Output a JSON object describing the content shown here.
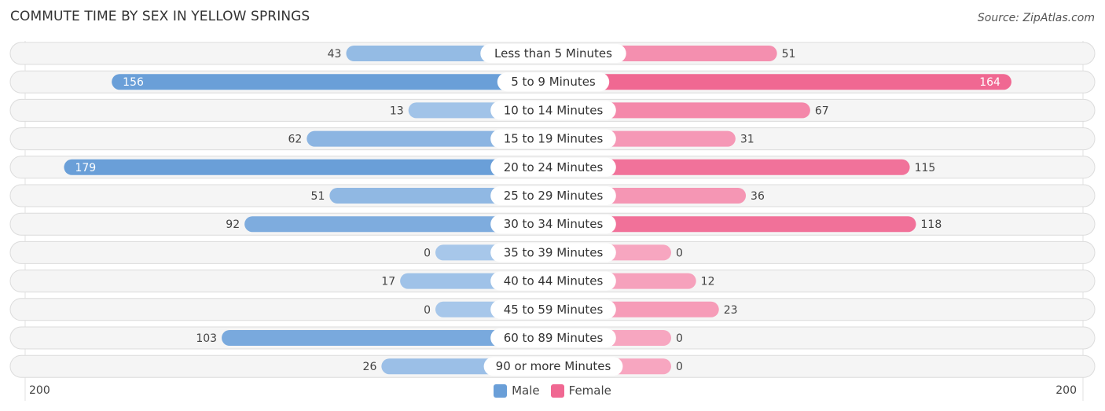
{
  "chart_data": {
    "type": "bar",
    "orientation": "horizontal-diverging",
    "title": "COMMUTE TIME BY SEX IN YELLOW SPRINGS",
    "source": "Source: ZipAtlas.com",
    "categories": [
      "Less than 5 Minutes",
      "5 to 9 Minutes",
      "10 to 14 Minutes",
      "15 to 19 Minutes",
      "20 to 24 Minutes",
      "25 to 29 Minutes",
      "30 to 34 Minutes",
      "35 to 39 Minutes",
      "40 to 44 Minutes",
      "45 to 59 Minutes",
      "60 to 89 Minutes",
      "90 or more Minutes"
    ],
    "series": [
      {
        "name": "Male",
        "color": "#6a9fd8",
        "light_color": "#a7c7ea",
        "values": [
          43,
          156,
          13,
          62,
          179,
          51,
          92,
          0,
          17,
          0,
          103,
          26
        ]
      },
      {
        "name": "Female",
        "color": "#f06892",
        "light_color": "#f7a6c0",
        "values": [
          51,
          164,
          67,
          31,
          115,
          36,
          118,
          0,
          12,
          23,
          0,
          0
        ]
      }
    ],
    "axis": {
      "left_label": "200",
      "right_label": "200",
      "max": 200
    },
    "legend": {
      "position": "bottom-center",
      "items": [
        "Male",
        "Female"
      ]
    }
  }
}
